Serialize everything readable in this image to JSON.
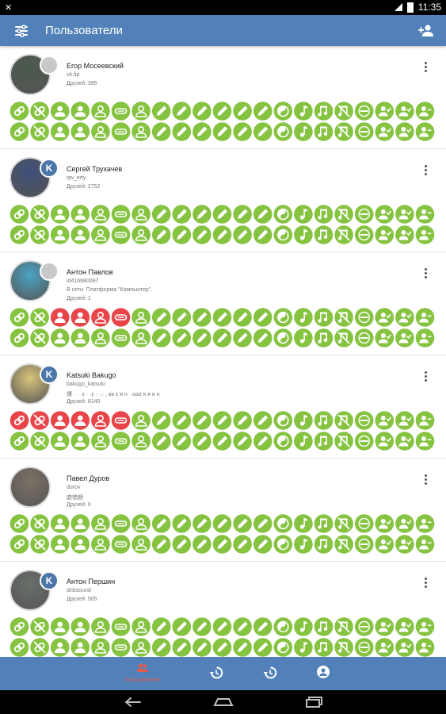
{
  "status_bar": {
    "left_icon": "notification-icon",
    "time": "11:35"
  },
  "app_bar": {
    "title": "Пользователи",
    "left_icon": "filter-icon",
    "right_icon": "add-user-icon"
  },
  "colors": {
    "app_bar": "#5181b8",
    "status_green": "#85c341",
    "status_red": "#e8454b"
  },
  "icon_types": [
    "link",
    "link-off",
    "person",
    "person",
    "person-outline",
    "sleep",
    "person-outline",
    "pencil",
    "pencil",
    "pencil",
    "pencil",
    "pencil",
    "pencil",
    "yin-yang",
    "music-note",
    "music",
    "music-off",
    "minus",
    "person-check",
    "person-check",
    "person-minus"
  ],
  "users": [
    {
      "name": "Егор Мосеевский",
      "lines": [
        "vk.fip",
        "Друзей: 395"
      ],
      "badge": "desktop",
      "row1_red": [],
      "row2_red": []
    },
    {
      "name": "Сергей Трухачев",
      "lines": [
        "qw_erty",
        "Друзей: 2752"
      ],
      "badge": "vk",
      "row1_red": [],
      "row2_red": []
    },
    {
      "name": "Антон Павлов",
      "lines": [
        "id416680097",
        "В сети. Платформа \"Компьютер\".",
        "Друзей: 1"
      ],
      "badge": "desktop",
      "row1_red": [
        2,
        3,
        4,
        5
      ],
      "row2_red": []
    },
    {
      "name": "Katsuki Bakugo",
      "lines": [
        "bakugo_katsuki",
        "爆 · · ·ε · ·ε · ·,·  ‚ ꞩꞩ ε ʀ  ʜ · ɢɢʀ ʀ ʀ ʀ    ʜ",
        "Друзей: 8140"
      ],
      "badge": "vk",
      "row1_red": [
        0,
        1,
        2,
        3,
        4,
        5
      ],
      "row2_red": []
    },
    {
      "name": "Павел Дуров",
      "lines": [
        "durov",
        "遊徳朗",
        "Друзей: 0"
      ],
      "badge": "none",
      "row1_red": [],
      "row2_red": []
    },
    {
      "name": "Антон Першин",
      "lines": [
        "dnbsound",
        "Друзей: 505"
      ],
      "badge": "vk",
      "row1_red": [],
      "row2_red": []
    }
  ],
  "bottom_nav": [
    {
      "label": "Пользователи",
      "icon": "users-icon",
      "active": true
    },
    {
      "label": "",
      "icon": "history-icon",
      "active": false
    },
    {
      "label": "",
      "icon": "history-icon",
      "active": false
    },
    {
      "label": "",
      "icon": "account-icon",
      "active": false
    }
  ],
  "system_nav": [
    "back-icon",
    "home-icon",
    "recents-icon"
  ]
}
